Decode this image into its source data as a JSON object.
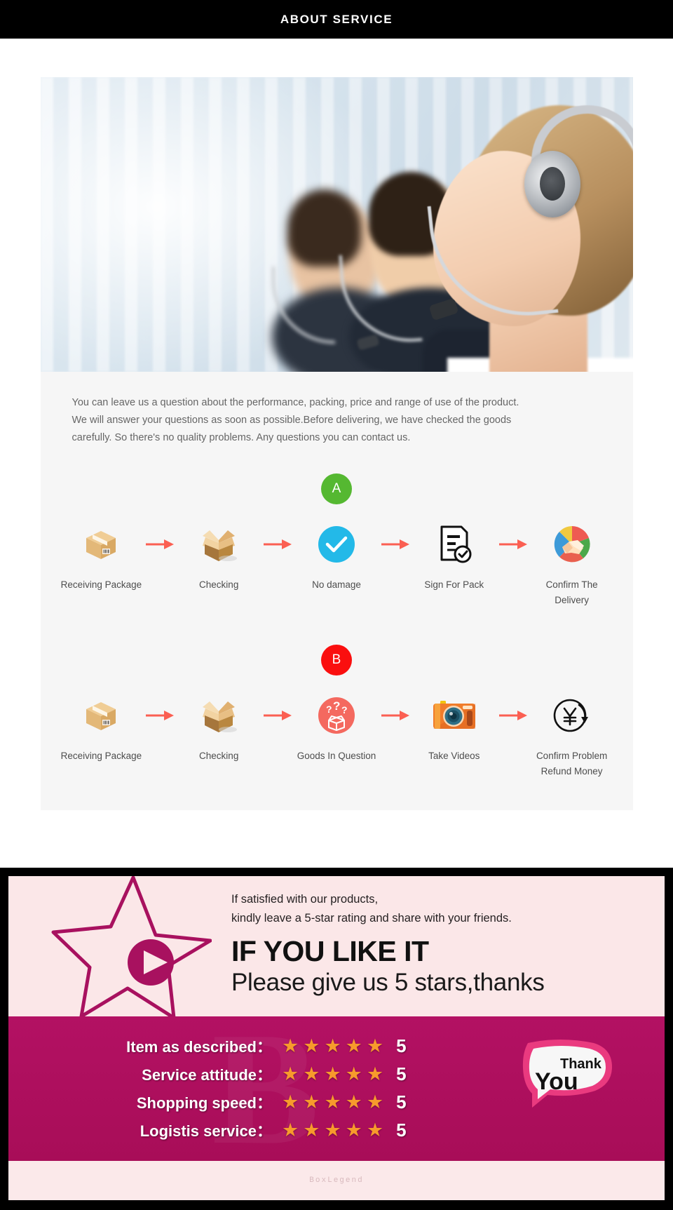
{
  "header": {
    "title": "ABOUT SERVICE"
  },
  "hero": {
    "alt": "call-center-agents-photo"
  },
  "description": {
    "line1": "You can leave us a question about the performance, packing, price and range of use of the product.",
    "line2": "We will answer your questions as soon as possible.Before delivering, we have checked the goods",
    "line3": "carefully. So there's no quality problems. Any questions you can contact us."
  },
  "flows": [
    {
      "badge": "A",
      "badge_color": "#55b831",
      "steps": [
        {
          "icon": "closed-box-icon",
          "label": "Receiving Package"
        },
        {
          "icon": "open-box-icon",
          "label": "Checking"
        },
        {
          "icon": "check-circle-icon",
          "label": "No damage"
        },
        {
          "icon": "sign-document-icon",
          "label": "Sign For Pack"
        },
        {
          "icon": "handshake-icon",
          "label": "Confirm The Delivery"
        }
      ],
      "arrow": "right-arrow-icon"
    },
    {
      "badge": "B",
      "badge_color": "#fa0f0f",
      "steps": [
        {
          "icon": "closed-box-icon",
          "label": "Receiving Package"
        },
        {
          "icon": "open-box-icon",
          "label": "Checking"
        },
        {
          "icon": "question-box-icon",
          "label": "Goods In Question"
        },
        {
          "icon": "camera-icon",
          "label": "Take Videos"
        },
        {
          "icon": "refund-yen-icon",
          "label": "Confirm Problem\nRefund Money"
        }
      ],
      "arrow": "right-arrow-icon"
    }
  ],
  "feedback": {
    "star_icon": "star-play-icon",
    "line1": "If satisfied with our products,",
    "line2": "kindly leave a 5-star rating and share with your friends.",
    "headline": "IF YOU LIKE IT",
    "subheadline": "Please give us 5 stars,thanks",
    "accent_color": "#ad0f5e",
    "panel_color": "#fbe7e8",
    "star_color": "#f79a2c",
    "ratings": [
      {
        "label": "Item as described：",
        "stars": 5,
        "value": "5"
      },
      {
        "label": "Service attitude：",
        "stars": 5,
        "value": "5"
      },
      {
        "label": "Shopping speed：",
        "stars": 5,
        "value": "5"
      },
      {
        "label": "Logistis service：",
        "stars": 5,
        "value": "5"
      }
    ],
    "thank_you": {
      "small": "Thank",
      "big": "You"
    },
    "watermark": "BoxLegend"
  }
}
